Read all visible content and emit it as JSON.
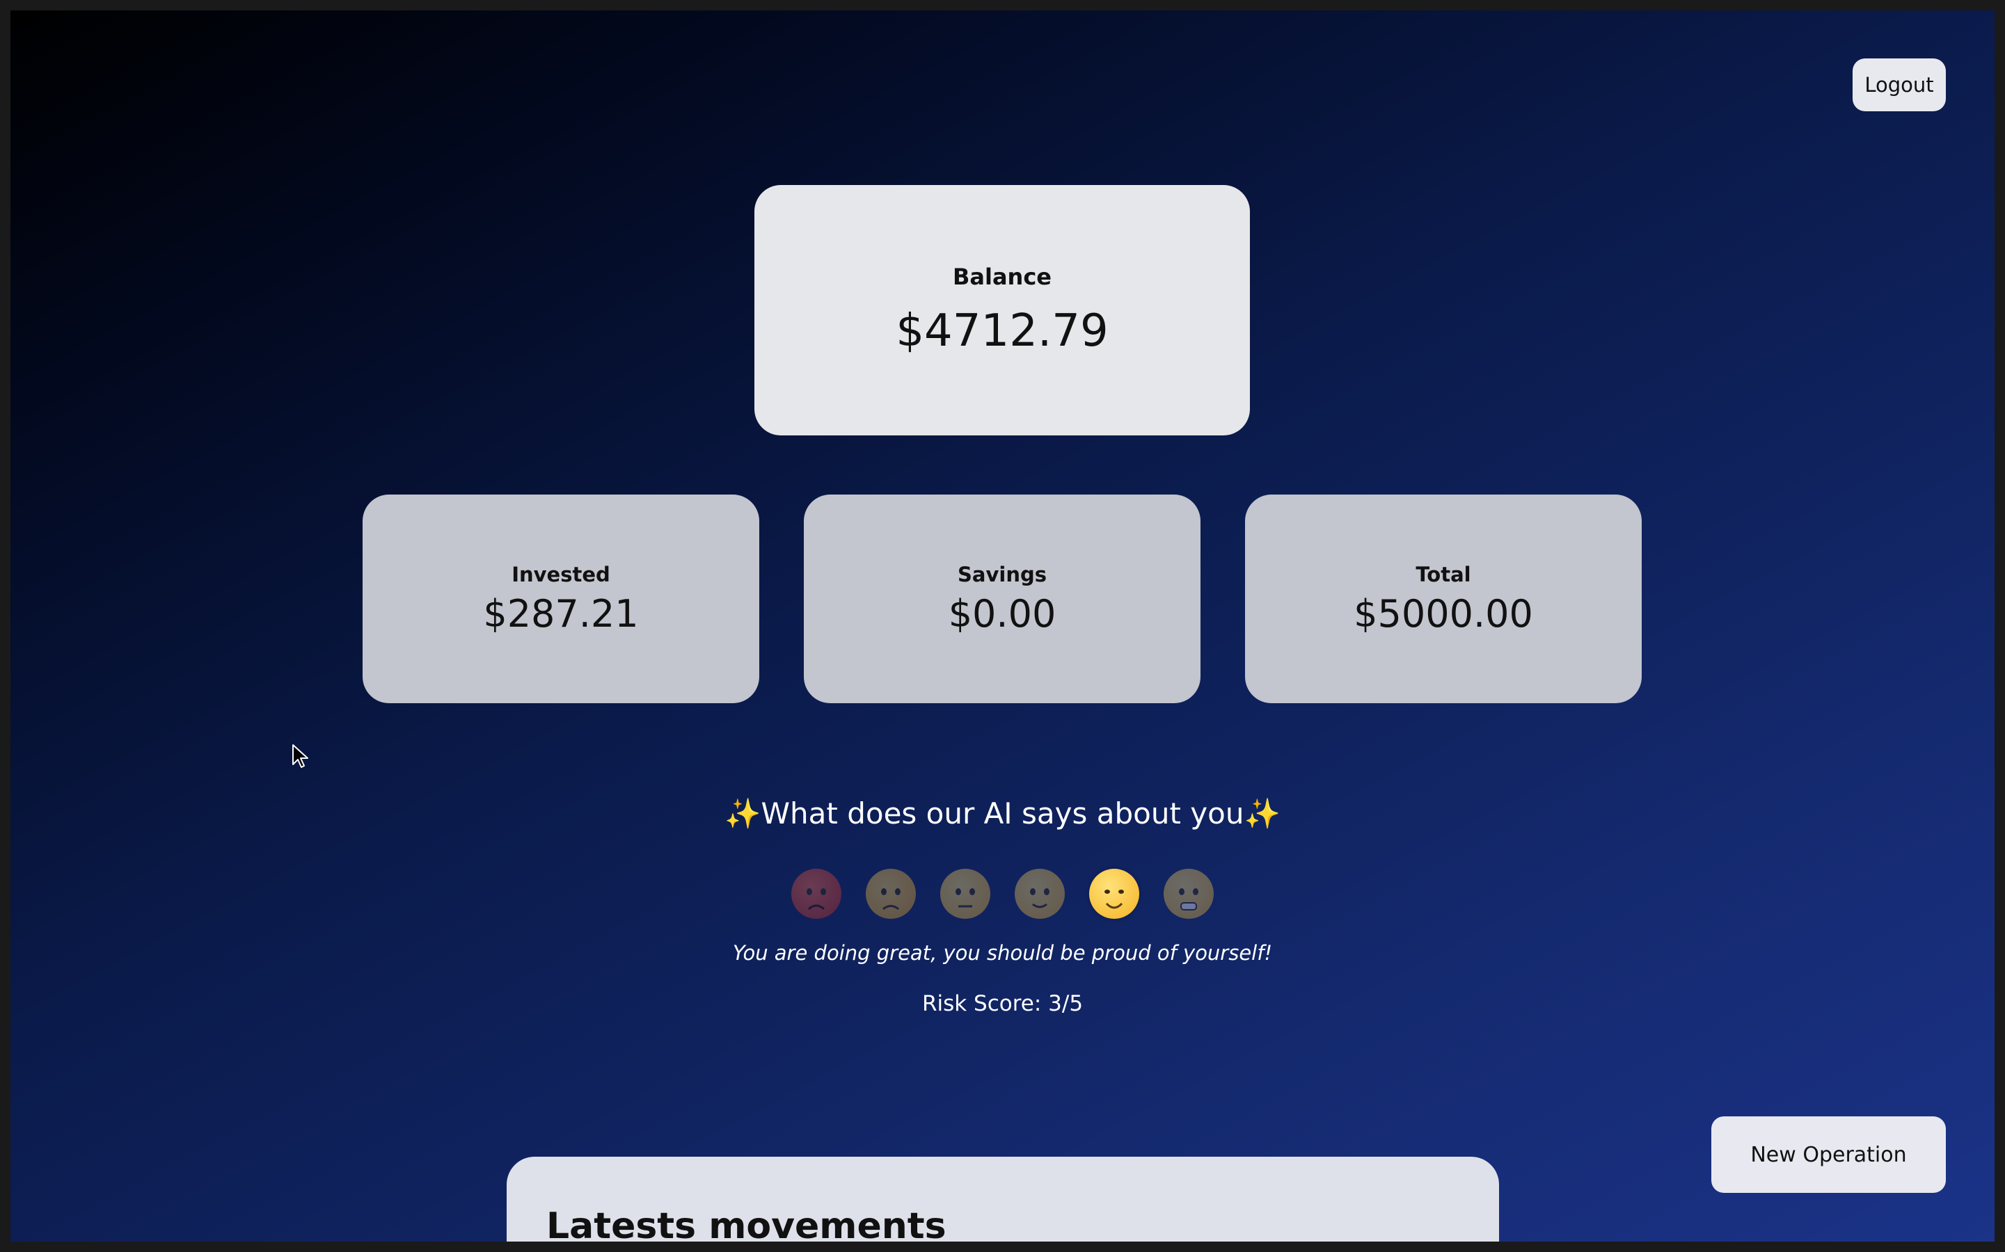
{
  "header": {
    "logout_label": "Logout"
  },
  "balance": {
    "label": "Balance",
    "value": "$4712.79"
  },
  "stats": [
    {
      "label": "Invested",
      "value": "$287.21"
    },
    {
      "label": "Savings",
      "value": "$0.00"
    },
    {
      "label": "Total",
      "value": "$5000.00"
    }
  ],
  "ai": {
    "title": "✨What does our AI says about you✨",
    "emojis": [
      {
        "icon": "furious-face-icon",
        "active": false
      },
      {
        "icon": "angry-face-icon",
        "active": false
      },
      {
        "icon": "neutral-face-icon",
        "active": false
      },
      {
        "icon": "slightly-smiling-face-icon",
        "active": false
      },
      {
        "icon": "smiling-face-icon",
        "active": true
      },
      {
        "icon": "grinning-face-icon",
        "active": false
      }
    ],
    "message": "You are doing great, you should be proud of yourself!",
    "risk_score": "Risk Score: 3/5"
  },
  "actions": {
    "new_operation_label": "New Operation"
  },
  "movements": {
    "title": "Latests movements"
  },
  "colors": {
    "card_primary": "#e6e7ea",
    "card_secondary": "#c3c5cf",
    "background_start": "#000000",
    "background_end": "#1b3388"
  }
}
